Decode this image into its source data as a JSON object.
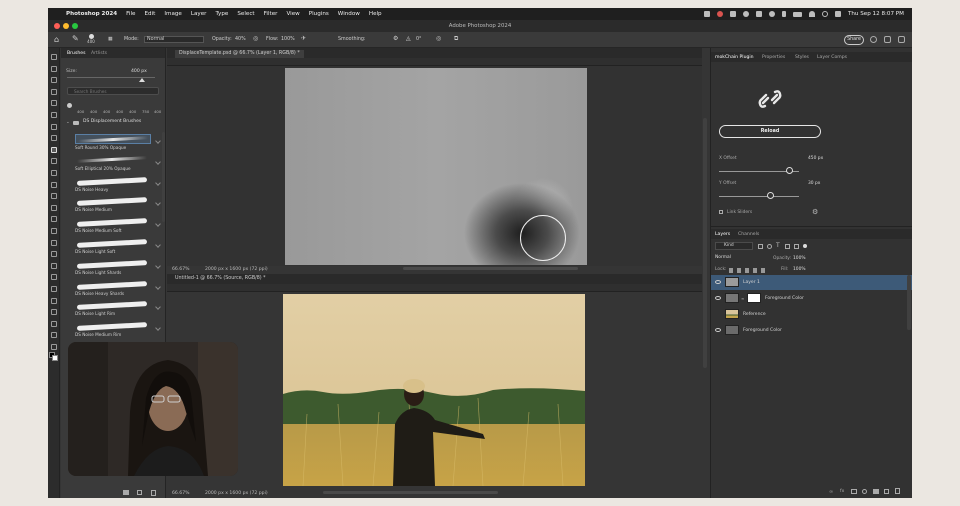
{
  "menubar": {
    "app": "Photoshop 2024",
    "items": [
      "File",
      "Edit",
      "Image",
      "Layer",
      "Type",
      "Select",
      "Filter",
      "View",
      "Plugins",
      "Window",
      "Help"
    ],
    "datetime": "Thu Sep 12  8:07 PM"
  },
  "window": {
    "title": "Adobe Photoshop 2024"
  },
  "options": {
    "brush_size": "400",
    "mode_label": "Mode:",
    "mode_value": "Normal",
    "opacity_label": "Opacity:",
    "opacity_value": "40%",
    "flow_label": "Flow:",
    "flow_value": "100%",
    "smoothing_label": "Smoothing:",
    "angle_value": "0°",
    "share_label": "Share"
  },
  "brushes_panel": {
    "tabs": [
      "Brushes",
      "Artlists"
    ],
    "size_label": "Size:",
    "size_value": "400 px",
    "search_placeholder": "Search Brushes",
    "recent_sizes": [
      "400",
      "400",
      "400",
      "400",
      "400",
      "750",
      "400"
    ],
    "group_name": "DS Displacement Brushes",
    "brushes": [
      "Soft Round 30% Opaque",
      "Soft Elliptical 20% Opaque",
      "DS Noise Heavy",
      "DS Noise Medium",
      "DS Noise Medium Soft",
      "DS Noise Light Soft",
      "DS Noise Light Shards",
      "DS Noise Heavy Shards",
      "DS Noise Light Rim",
      "DS Noise Medium Rim"
    ]
  },
  "doc1": {
    "tab": "DisplaceTemplate.psd @ 66.7% (Layer 1, RGB/8) *",
    "zoom": "66.67%",
    "dims": "2000 px x 1600 px (72 ppi)"
  },
  "doc2": {
    "tab": "Untitled-1 @ 66.7% (Source, RGB/8) *",
    "zoom": "66.67%",
    "dims": "2000 px x 1600 px (72 ppi)"
  },
  "plugin_panel": {
    "tabs": [
      "mokChain Plugin",
      "Properties",
      "Styles",
      "Layer Comps"
    ],
    "reload_label": "Reload",
    "x_offset_label": "X Offset",
    "x_offset_value": "450 px",
    "x_offset_level": 0.84,
    "y_offset_label": "Y Offset",
    "y_offset_value": "30 px",
    "y_offset_level": 0.6,
    "link_sliders_label": "Link Sliders"
  },
  "layers_panel": {
    "tabs": [
      "Layers",
      "Channels"
    ],
    "kind_label": "Kind",
    "blend_mode": "Normal",
    "opacity_label": "Opacity:",
    "opacity_value": "100%",
    "lock_label": "Lock:",
    "fill_label": "Fill:",
    "fill_value": "100%",
    "layers": [
      {
        "name": "Layer 1",
        "selected": true,
        "visible": true
      },
      {
        "name": "Foreground Color",
        "selected": false,
        "visible": true
      },
      {
        "name": "Reference",
        "selected": false,
        "visible": false
      },
      {
        "name": "Foreground Color",
        "selected": false,
        "visible": true
      }
    ]
  },
  "colors": {
    "accent": "#2f6fb0",
    "selected_layer": "#3d5a78"
  }
}
